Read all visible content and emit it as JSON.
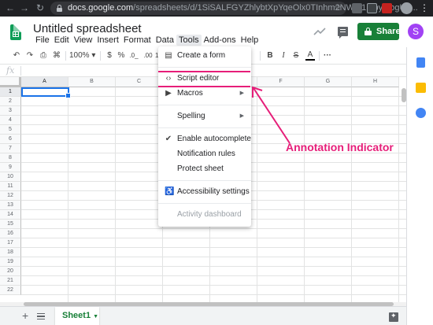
{
  "browser": {
    "url_host": "docs.google.com",
    "url_path": "/spreadsheets/d/1SiSALFGYZhlybtXpYqeOlx0TInhm2NW0I1MbymogU9...",
    "icons": [
      "back-icon",
      "forward-icon",
      "reload-icon",
      "lock-icon",
      "star-icon",
      "extension-icon",
      "profile-icon",
      "menu-icon"
    ]
  },
  "app": {
    "title": "Untitled spreadsheet",
    "menu": [
      "File",
      "Edit",
      "View",
      "Insert",
      "Format",
      "Data",
      "Tools",
      "Add-ons",
      "Help"
    ],
    "active_menu": "Tools",
    "share_label": "Share",
    "avatar_letter": "S",
    "accent_color": "#188038"
  },
  "toolbar": {
    "zoom": "100%",
    "currency": "$",
    "percent": "%",
    "dec_less": ".0_",
    "dec_more": ".00",
    "more_formats": "12",
    "bold": "B",
    "italic": "I",
    "strike": "S",
    "text_color": "A",
    "more": "···"
  },
  "formula_bar": {
    "fx": "fx"
  },
  "grid": {
    "columns": [
      "A",
      "B",
      "C",
      "D",
      "E",
      "F",
      "G",
      "H"
    ],
    "rows": [
      "1",
      "2",
      "3",
      "4",
      "5",
      "6",
      "7",
      "8",
      "9",
      "10",
      "11",
      "12",
      "13",
      "14",
      "15",
      "16",
      "17",
      "18",
      "19",
      "20",
      "21",
      "22"
    ],
    "active_cell": "A1"
  },
  "tools_menu": {
    "items": [
      {
        "label": "Create a form",
        "icon": "form-icon"
      },
      {
        "label": "Script editor",
        "icon": "code-icon"
      },
      {
        "label": "Macros",
        "icon": "play-icon",
        "submenu": true
      },
      {
        "label": "Spelling",
        "submenu": true
      },
      {
        "label": "Enable autocomplete",
        "checked": true
      },
      {
        "label": "Notification rules"
      },
      {
        "label": "Protect sheet"
      },
      {
        "label": "Accessibility settings",
        "icon": "accessibility-icon"
      },
      {
        "label": "Activity dashboard",
        "disabled": true
      }
    ]
  },
  "annotation": {
    "text": "Annotation Indicator",
    "color": "#e61e79"
  },
  "sheets": {
    "tabs": [
      {
        "label": "Sheet1"
      }
    ]
  }
}
